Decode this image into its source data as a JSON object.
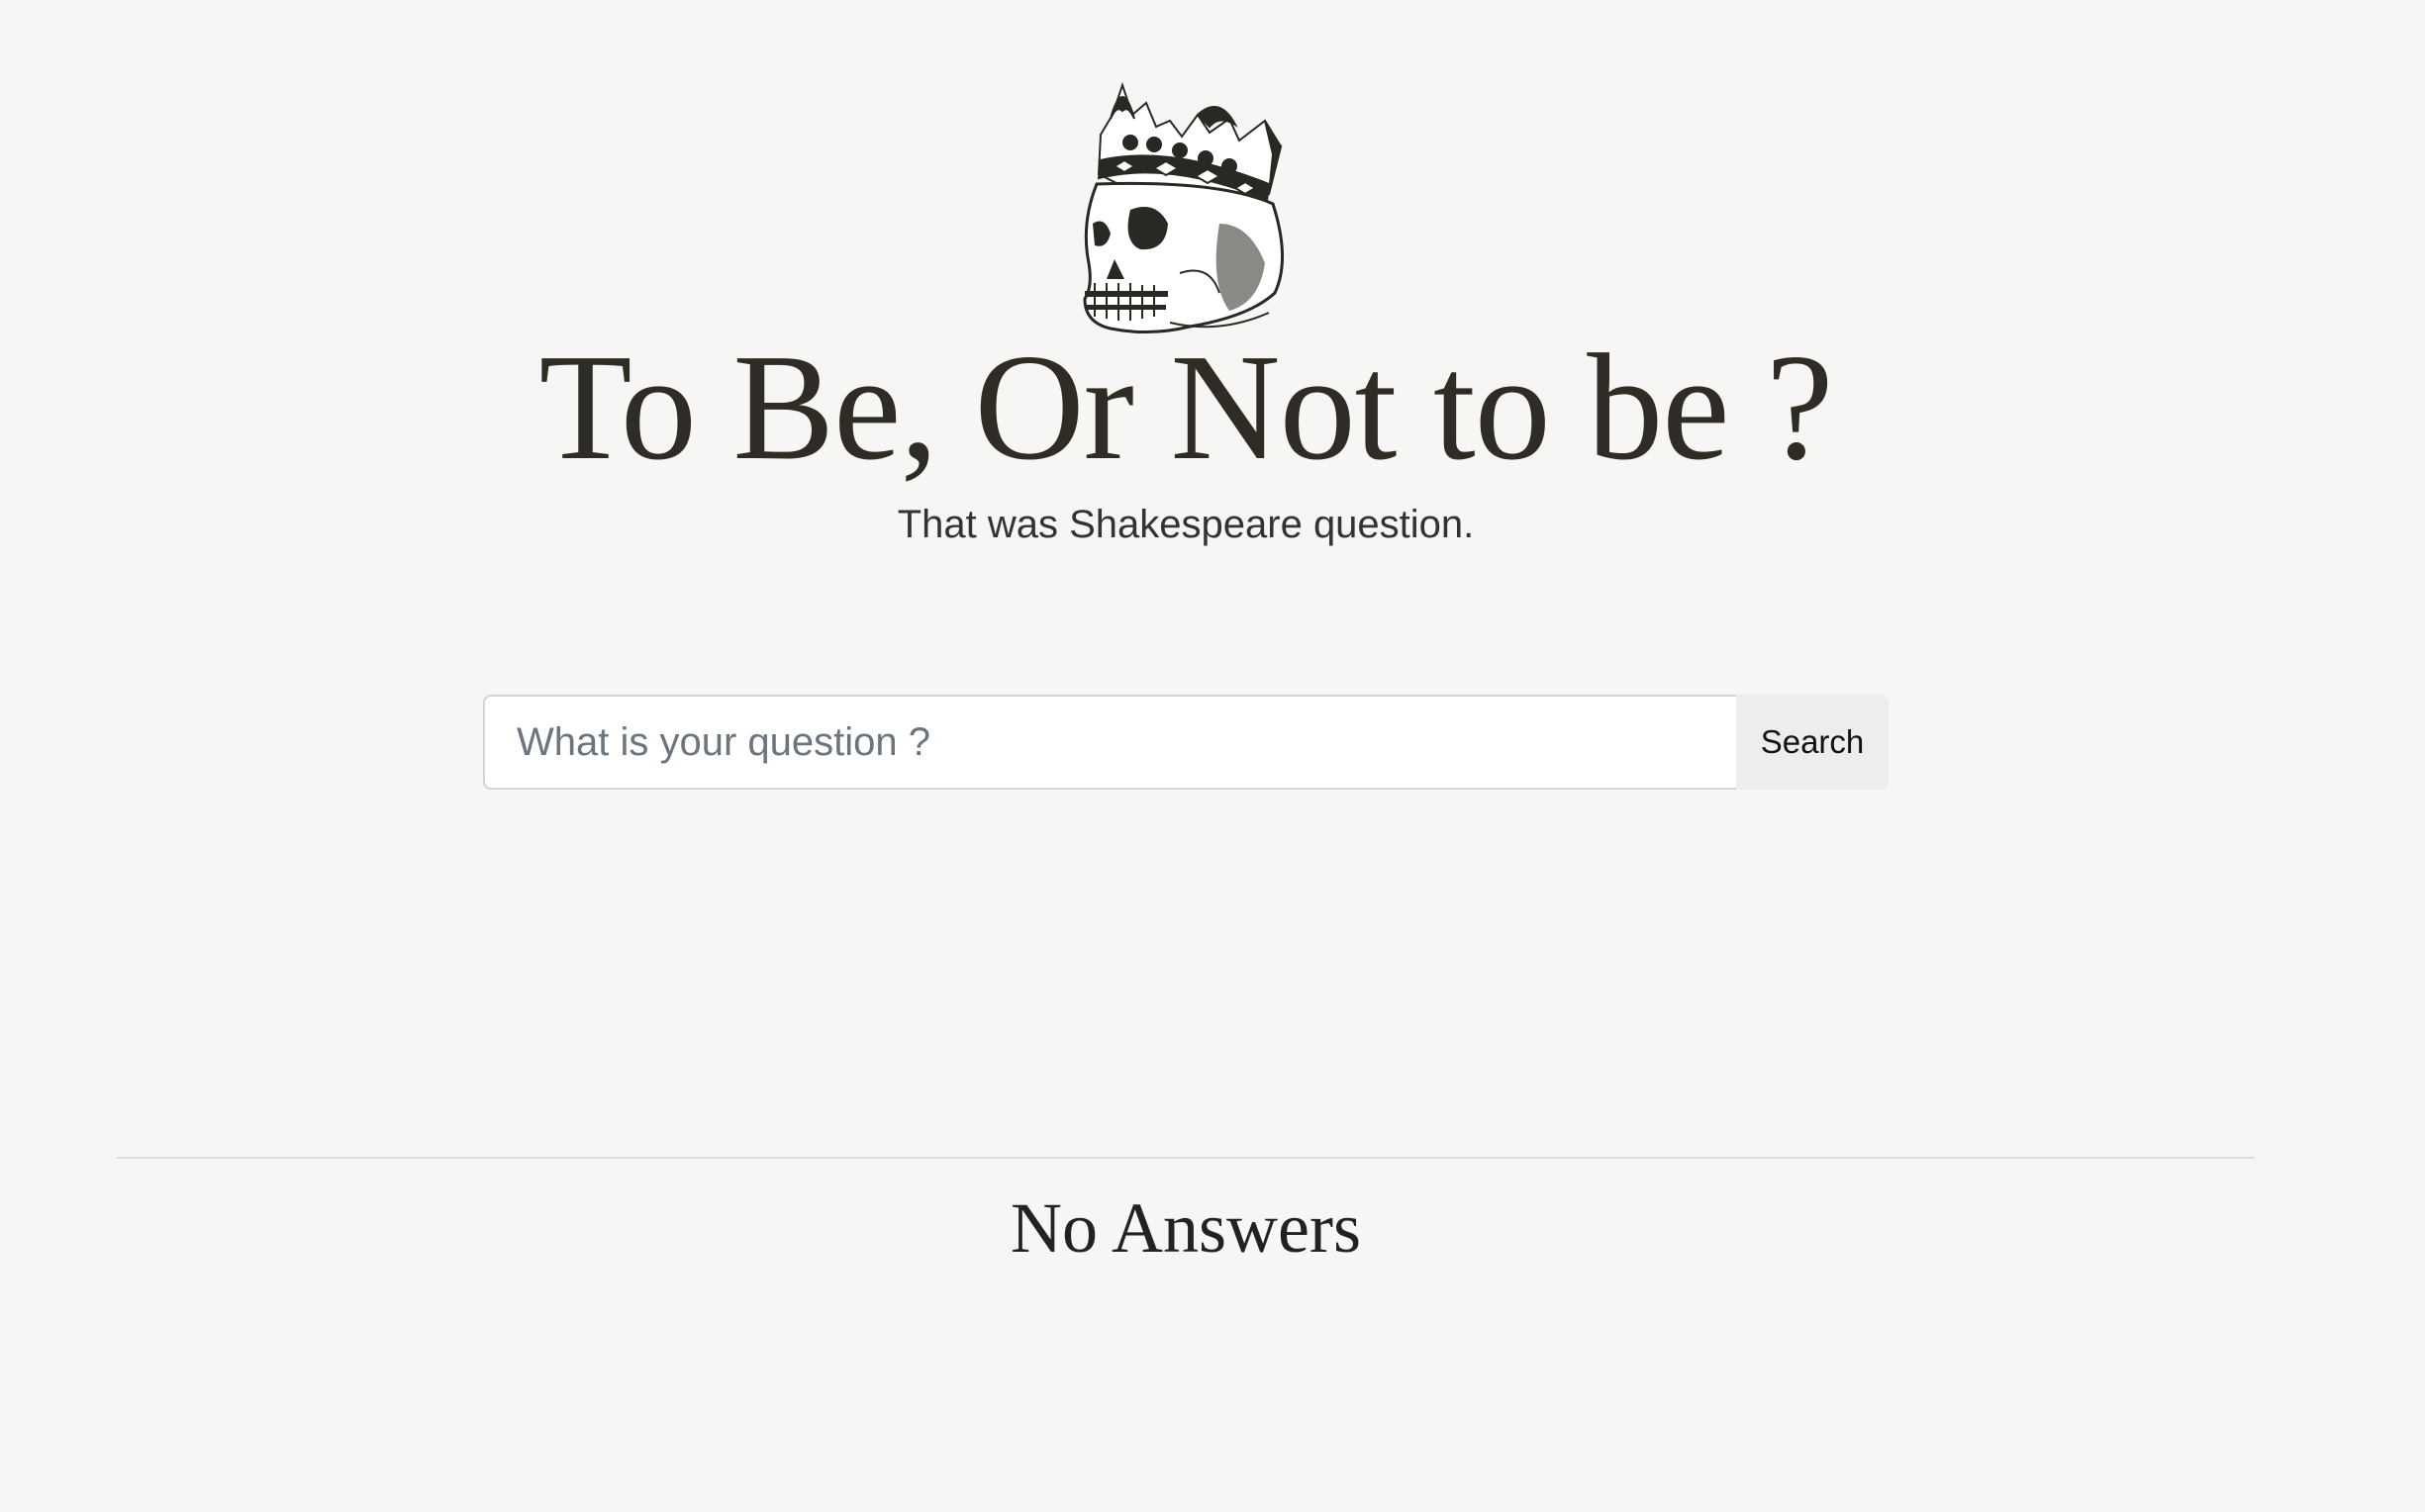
{
  "header": {
    "logo_icon": "crowned-skull-icon",
    "title": "To Be, Or Not to be ?",
    "subtitle": "That was Shakespeare question."
  },
  "search": {
    "placeholder": "What is your question ?",
    "value": "",
    "button_label": "Search"
  },
  "answers": {
    "heading": "No Answers"
  },
  "colors": {
    "background": "#f7f6f4",
    "title": "#2e2c25",
    "button_bg": "#ededed",
    "input_border": "#d4d4d4"
  }
}
